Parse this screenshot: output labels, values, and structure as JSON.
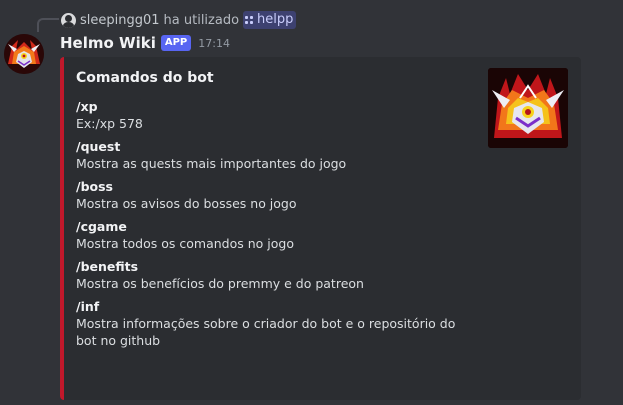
{
  "reply": {
    "username": "sleepingg01",
    "action_text": "ha utilizado",
    "command": "helpp"
  },
  "message": {
    "bot_name": "Helmo Wiki",
    "badge": "APP",
    "time": "17:14",
    "avatar_icon": "helmet-logo-icon"
  },
  "embed": {
    "accent_color": "#c0182b",
    "title": "Comandos do bot",
    "thumbnail_icon": "helmet-logo-icon",
    "fields": [
      {
        "name": "/xp",
        "value": "Ex:/xp 578"
      },
      {
        "name": "/quest",
        "value": "Mostra as quests mais importantes do jogo"
      },
      {
        "name": "/boss",
        "value": "Mostra os avisos do bosses no jogo"
      },
      {
        "name": "/cgame",
        "value": "Mostra todos os comandos no jogo"
      },
      {
        "name": "/benefits",
        "value": "Mostra os benefícios do premmy e do patreon"
      },
      {
        "name": "/inf",
        "value": "Mostra informações sobre o criador do bot e o repositório do bot no github"
      }
    ]
  },
  "colors": {
    "background": "#313338",
    "embed_bg": "#2b2d31",
    "badge": "#5865f2"
  }
}
